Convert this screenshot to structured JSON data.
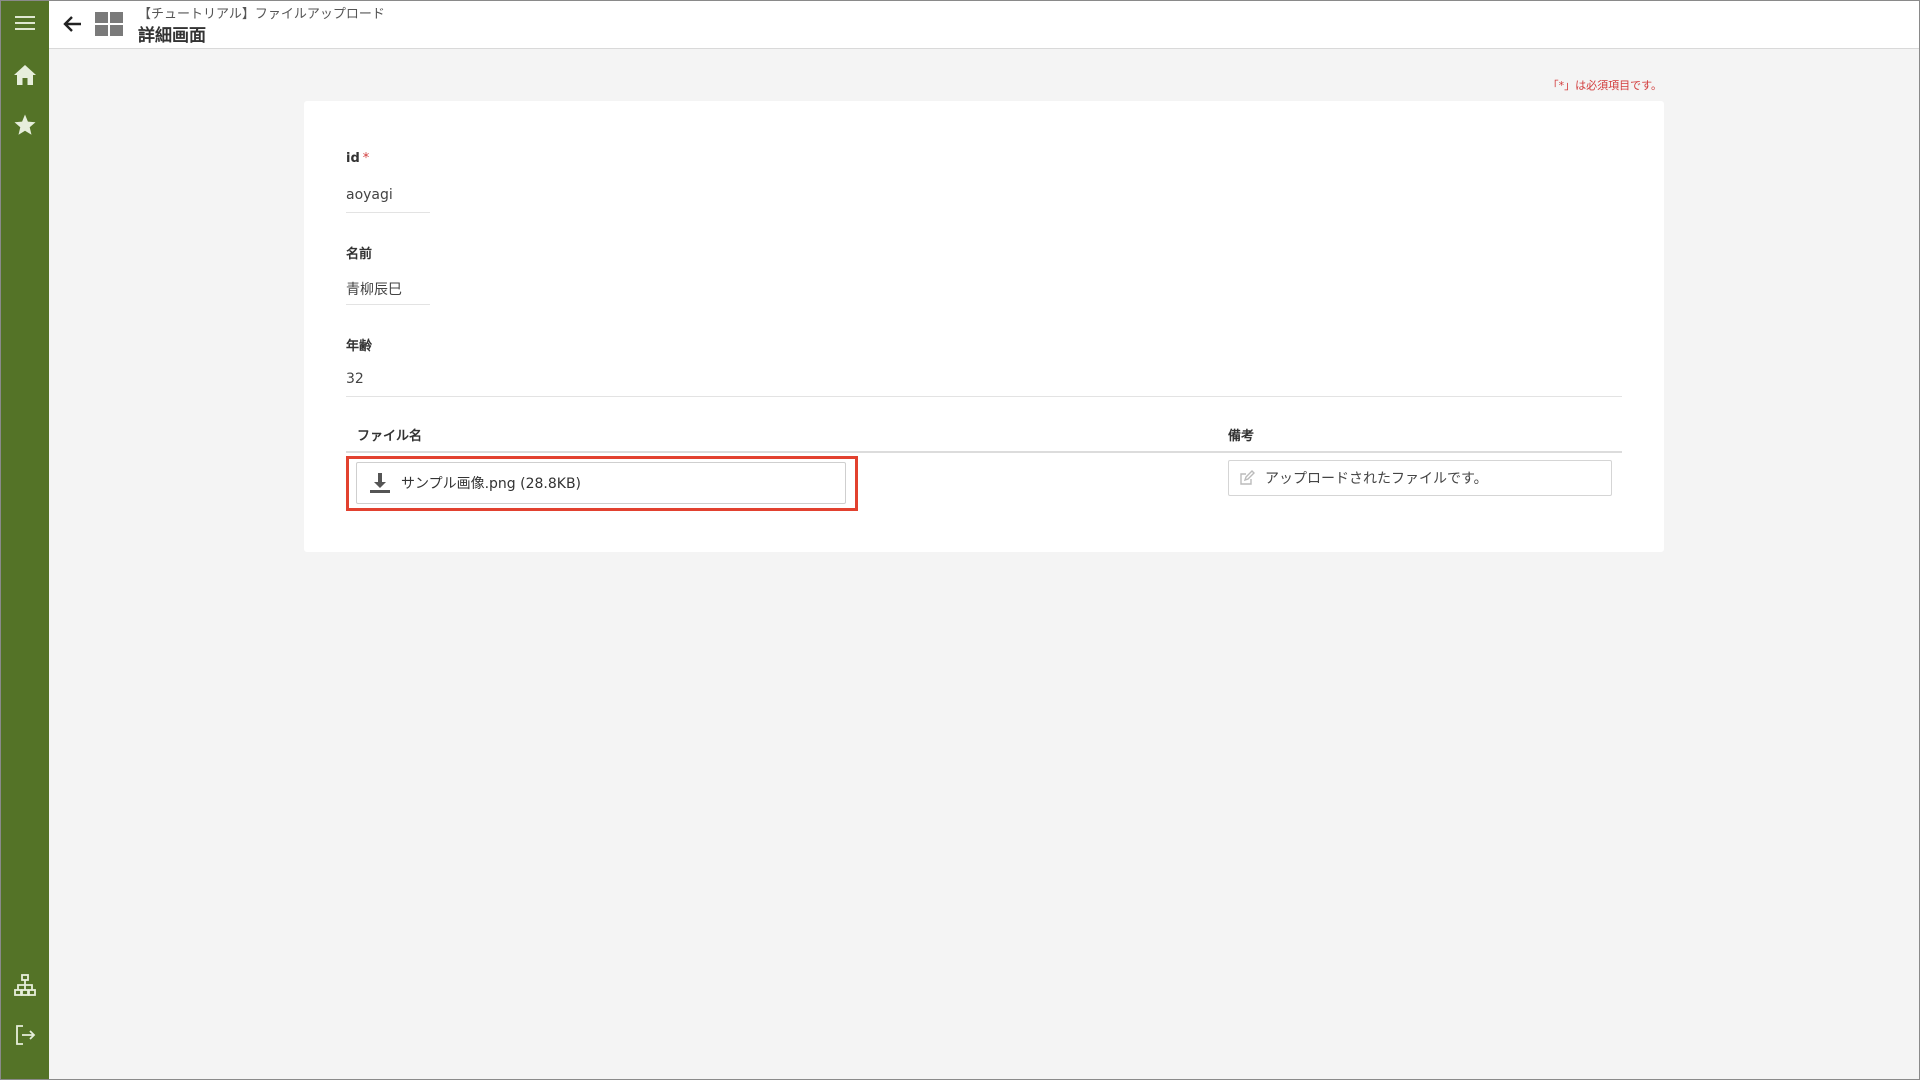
{
  "header": {
    "app_name": "【チュートリアル】ファイルアップロード",
    "page_title": "詳細画面"
  },
  "sidebar": {
    "items": [
      {
        "icon": "menu-icon"
      },
      {
        "icon": "home-icon"
      },
      {
        "icon": "star-icon"
      },
      {
        "icon": "sitemap-icon"
      },
      {
        "icon": "logout-icon"
      }
    ]
  },
  "form": {
    "required_note": "「*」は必須項目です。",
    "fields": {
      "id": {
        "label": "id",
        "required_mark": "*",
        "value": "aoyagi"
      },
      "name": {
        "label": "名前",
        "value": "青柳辰巳"
      },
      "age": {
        "label": "年齢",
        "value": "32"
      }
    },
    "table": {
      "col_file_name": "ファイル名",
      "col_remarks": "備考",
      "file_name": "サンプル画像.png (28.8KB)",
      "remarks": "アップロードされたファイルです。"
    }
  },
  "colors": {
    "sidebar": "#547327",
    "highlight": "#e2412f",
    "required": "#d23c3c"
  }
}
